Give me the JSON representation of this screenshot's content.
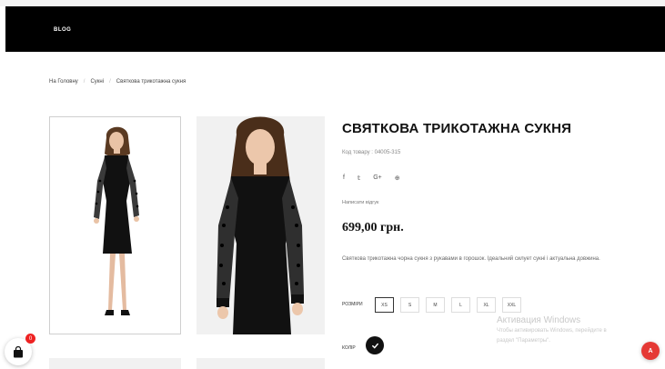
{
  "nav": {
    "blog_label": "BLOG"
  },
  "breadcrumb": {
    "items": [
      "На Головну",
      "Сукні",
      "Святкова трикотажна сукня"
    ],
    "separator": "/"
  },
  "product": {
    "title": "СВЯТКОВА ТРИКОТАЖНА СУКНЯ",
    "sku": "Код товару : 04005-315",
    "social_icons": [
      "facebook-icon",
      "twitter-icon",
      "google-plus-icon",
      "pinterest-icon"
    ],
    "social_glyphs": [
      "f",
      "𝕥",
      "G+",
      "⊕"
    ],
    "write_review": "Написати відгук",
    "price": "699,00 грн.",
    "description": "Святкова трикотажна чорна сукня з рукавами в горошок. Ідеальний силует сукні і актуальна довжина.",
    "size_label": "РОЗМІРИ",
    "sizes": [
      "XS",
      "S",
      "M",
      "L",
      "XL",
      "XXL"
    ],
    "selected_size": "XS",
    "color_label": "КОЛІР",
    "selected_color": "#111111"
  },
  "cart": {
    "count": "0"
  },
  "chat": {
    "label": "A"
  },
  "watermark": {
    "line1": "Активация Windows",
    "line2": "Чтобы активировать Windows, перейдите в",
    "line3": "раздел \"Параметры\"."
  }
}
